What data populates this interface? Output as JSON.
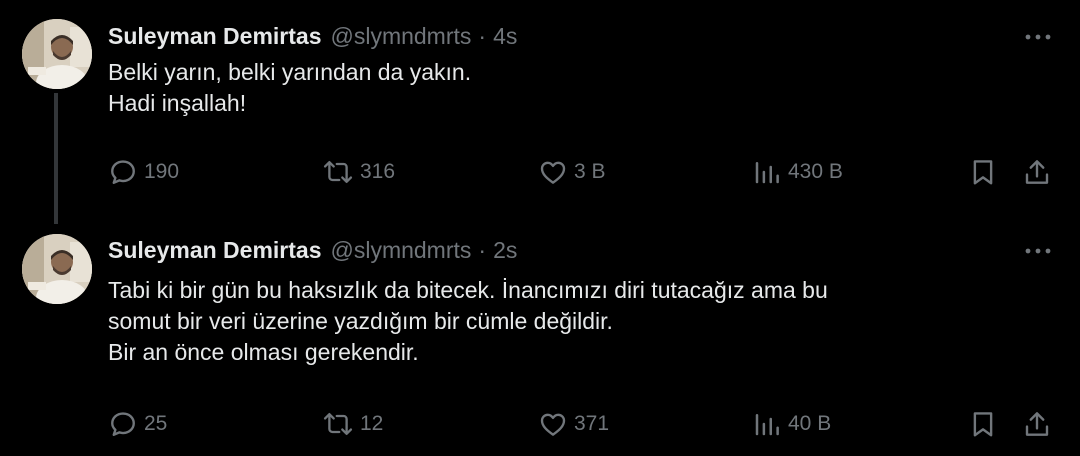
{
  "colors": {
    "background": "#000000",
    "primary_text": "#e7e9ea",
    "secondary_text": "#71767b",
    "thread_line": "#333639"
  },
  "tweets": [
    {
      "author_name": "Suleyman Demirtas",
      "handle": "@slymndmrts",
      "separator": "·",
      "time": "4s",
      "text_lines": [
        "Belki yarın, belki yarından da yakın.",
        "Hadi inşallah!"
      ],
      "replies": "190",
      "retweets": "316",
      "likes": "3 B",
      "views": "430 B",
      "icons": [
        "reply-icon",
        "retweet-icon",
        "like-icon",
        "views-icon",
        "bookmark-icon",
        "share-icon",
        "more-icon"
      ]
    },
    {
      "author_name": "Suleyman Demirtas",
      "handle": "@slymndmrts",
      "separator": "·",
      "time": "2s",
      "text_lines": [
        "Tabi ki bir gün bu haksızlık da bitecek. İnancımızı diri tutacağız ama bu",
        "somut bir veri üzerine yazdığım bir cümle değildir.",
        "Bir an önce olması gerekendir."
      ],
      "replies": "25",
      "retweets": "12",
      "likes": "371",
      "views": "40 B",
      "icons": [
        "reply-icon",
        "retweet-icon",
        "like-icon",
        "views-icon",
        "bookmark-icon",
        "share-icon",
        "more-icon"
      ]
    }
  ]
}
